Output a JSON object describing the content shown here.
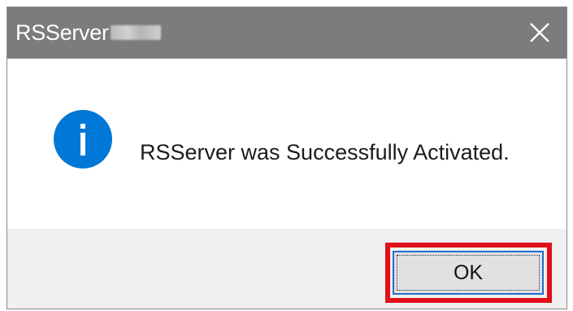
{
  "dialog": {
    "title": "RSServer",
    "message": "RSServer was Successfully Activated.",
    "ok_label": "OK"
  },
  "icons": {
    "info": "info-icon",
    "close": "close-icon"
  },
  "colors": {
    "titlebar": "#7c7c7c",
    "info_icon": "#0078d7",
    "footer": "#f0f0f0",
    "button_focus": "#1f6fd0",
    "highlight": "#e0101a"
  }
}
